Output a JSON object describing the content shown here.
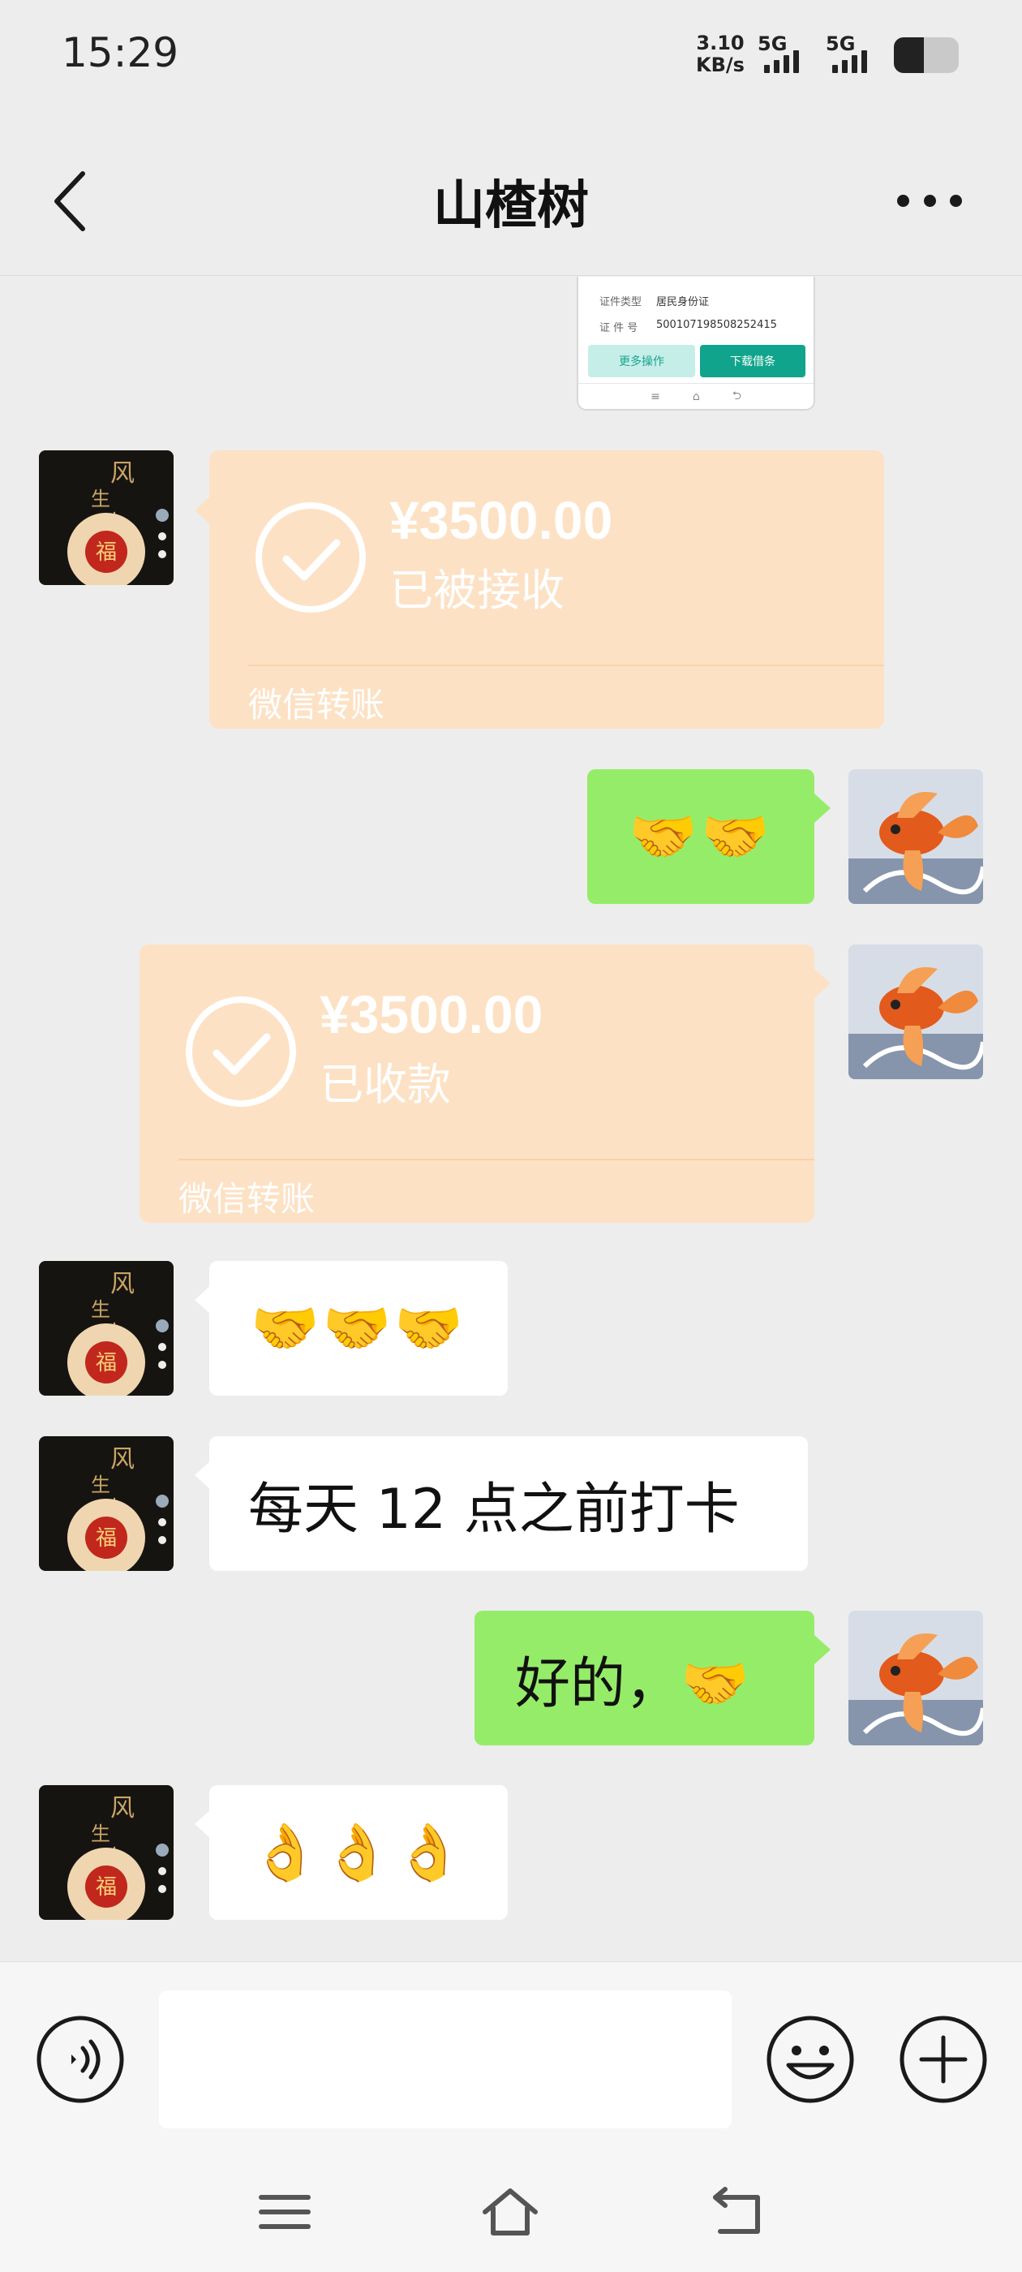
{
  "status_bar": {
    "time": "15:29",
    "net_speed_value": "3.10",
    "net_speed_unit": "KB/s",
    "sim1_label": "5G",
    "sim2_label": "5G",
    "battery_level": 0.46
  },
  "header": {
    "title": "山楂树",
    "back_icon": "chevron-left-icon",
    "more_icon": "more-dots-icon"
  },
  "messages": {
    "partial_image": {
      "row1_label": "证件类型",
      "row1_value": "居民身份证",
      "row2_label": "证 件 号",
      "row2_value": "500107198508252415",
      "button_more": "更多操作",
      "button_download": "下载借条",
      "nav_glyphs": [
        "≡",
        "⌂",
        "⮌"
      ]
    },
    "transfer_received": {
      "amount": "¥3500.00",
      "status": "已被接收",
      "footer": "微信转账"
    },
    "sent_emoji_1": "🤝🤝",
    "transfer_collected": {
      "amount": "¥3500.00",
      "status": "已收款",
      "footer": "微信转账"
    },
    "received_emoji_1": "🤝🤝🤝",
    "received_text_1": "每天 12 点之前打卡",
    "sent_text_1": "好的，🤝",
    "received_emoji_2": "👌👌👌"
  },
  "input_bar": {
    "voice_icon": "voice-icon",
    "emoji_icon": "emoji-icon",
    "plus_icon": "plus-icon",
    "input_value": ""
  },
  "nav_bar": {
    "menu_icon": "menu-icon",
    "home_icon": "home-icon",
    "back_icon": "back-icon"
  },
  "colors": {
    "background": "#ededed",
    "sent_bubble": "#95ec69",
    "received_bubble": "#ffffff",
    "transfer_card": "#fde1c4"
  }
}
